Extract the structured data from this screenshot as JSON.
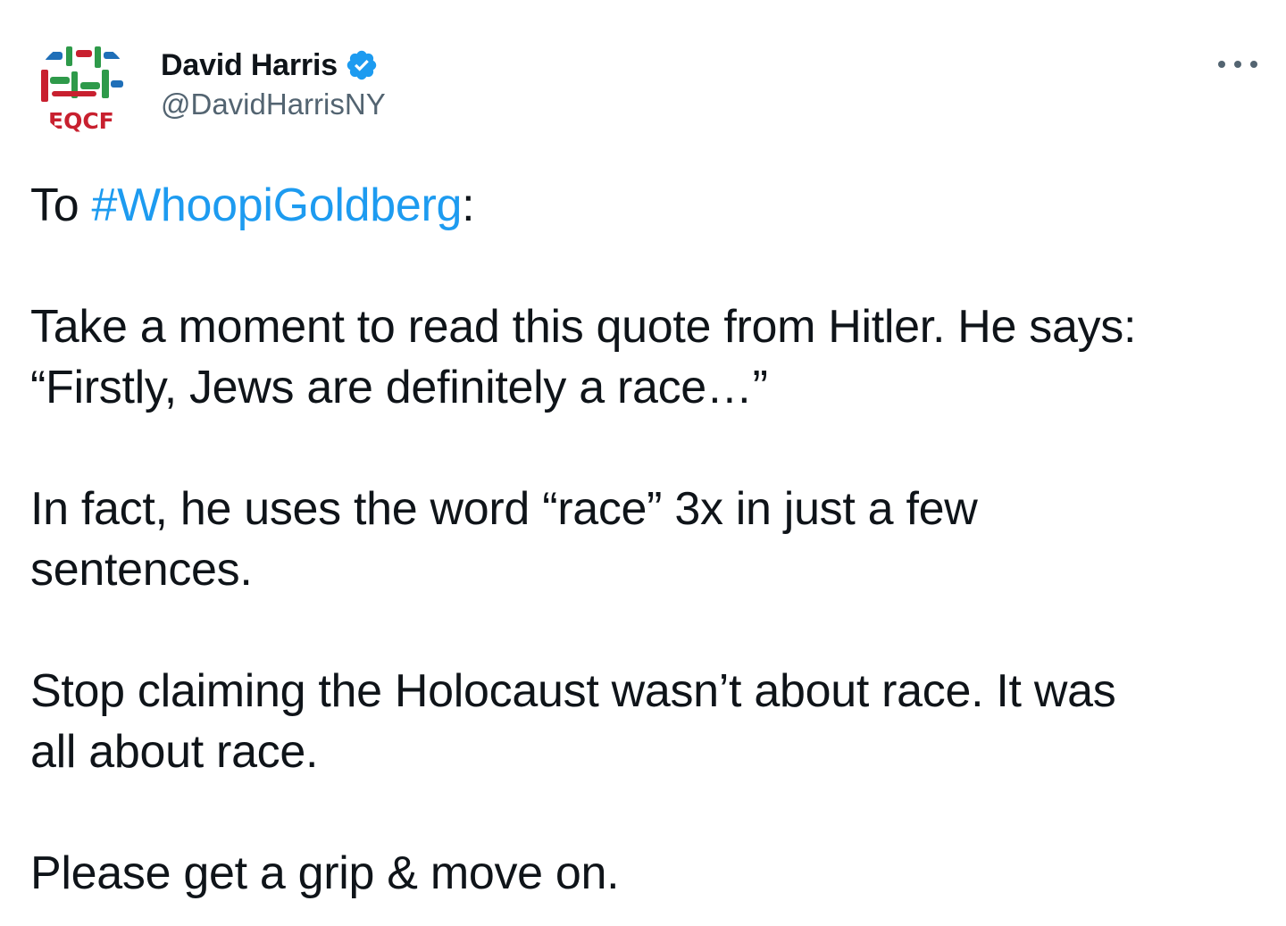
{
  "author": {
    "display_name": "David Harris",
    "handle": "@DavidHarrisNY",
    "verified_icon": "verified-badge-icon",
    "avatar_icon": "organization-logo-icon",
    "avatar_text": "EQCF"
  },
  "menu": {
    "more_icon": "more-options-icon"
  },
  "tweet": {
    "p1_prefix": "To ",
    "p1_hashtag": "#WhoopiGoldberg",
    "p1_suffix": ":",
    "p2_line1": "Take a moment to read this quote from Hitler. He says:",
    "p2_line2": "“Firstly, Jews are definitely a race…”",
    "p3_line1": "In fact, he uses the word “race” 3x in just a few",
    "p3_line2": "sentences.",
    "p4_line1": "Stop claiming the Holocaust wasn’t about race. It was",
    "p4_line2": "all about race.",
    "p5_line1": "Please get a grip & move on."
  },
  "colors": {
    "link": "#1d9bf0",
    "text": "#0f1419",
    "secondary": "#536471",
    "logo_green": "#2e9a4a",
    "logo_red": "#c8202f",
    "logo_blue": "#1f6fb8"
  }
}
